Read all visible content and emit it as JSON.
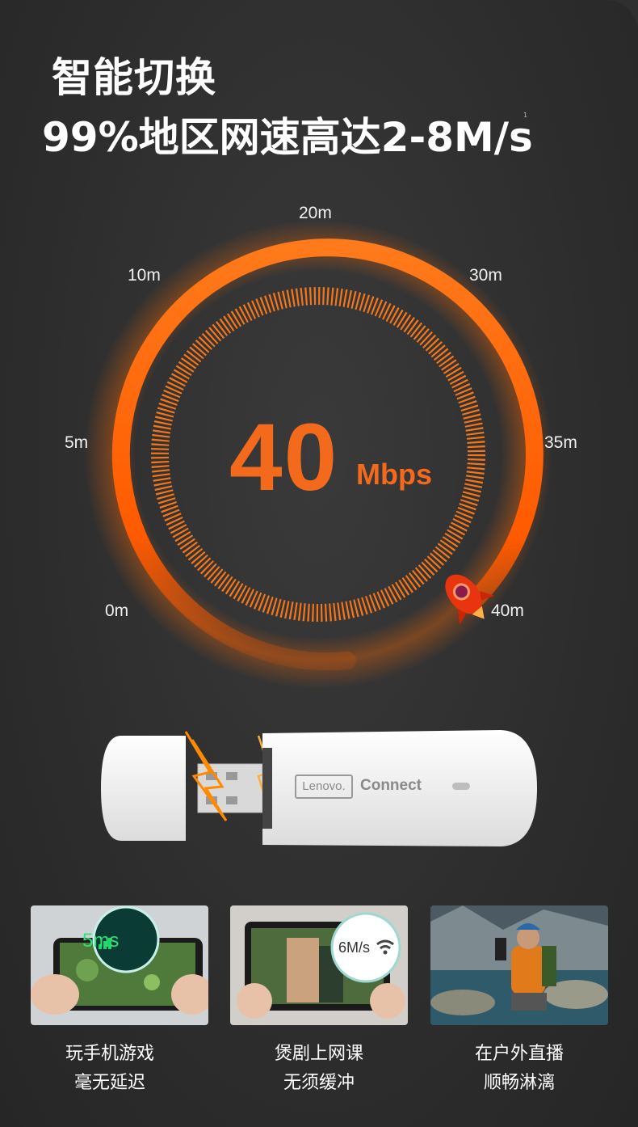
{
  "header": {
    "title_line1": "智能切换",
    "title_line2": "99%地区网速高达2-8M/s",
    "footnote_mark": "1"
  },
  "gauge": {
    "labels": [
      "0m",
      "5m",
      "10m",
      "20m",
      "30m",
      "35m",
      "40m"
    ],
    "speed_value": "40",
    "speed_unit": "Mbps",
    "accent_color": "#f36a1c",
    "arc_color": "#ff6a00"
  },
  "device": {
    "brand": "Lenovo.",
    "sub_brand": "Connect"
  },
  "features": [
    {
      "badge": "5ms",
      "line1": "玩手机游戏",
      "line2": "毫无延迟"
    },
    {
      "badge": "6M/s",
      "line1": "煲剧上网课",
      "line2": "无须缓冲"
    },
    {
      "badge": "",
      "line1": "在户外直播",
      "line2": "顺畅淋漓"
    }
  ]
}
